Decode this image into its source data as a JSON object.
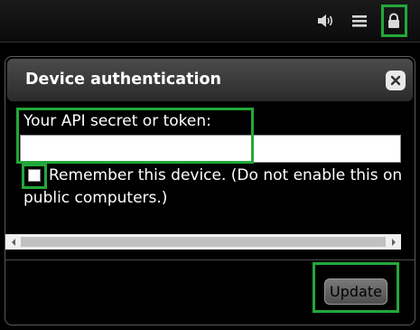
{
  "toolbar": {
    "icons": [
      "speaker-icon",
      "hamburger-menu-icon",
      "lock-icon"
    ]
  },
  "dialog": {
    "title": "Device authentication",
    "close_icon": "close-icon",
    "api_label": "Your API secret or token:",
    "api_value": "",
    "remember_label": "Remember this device. (Do not enable this on public computers.)",
    "remember_checked": false,
    "update_label": "Update"
  },
  "colors": {
    "highlight": "#22a83a",
    "header": "#3a3a3a",
    "background": "#000000"
  }
}
